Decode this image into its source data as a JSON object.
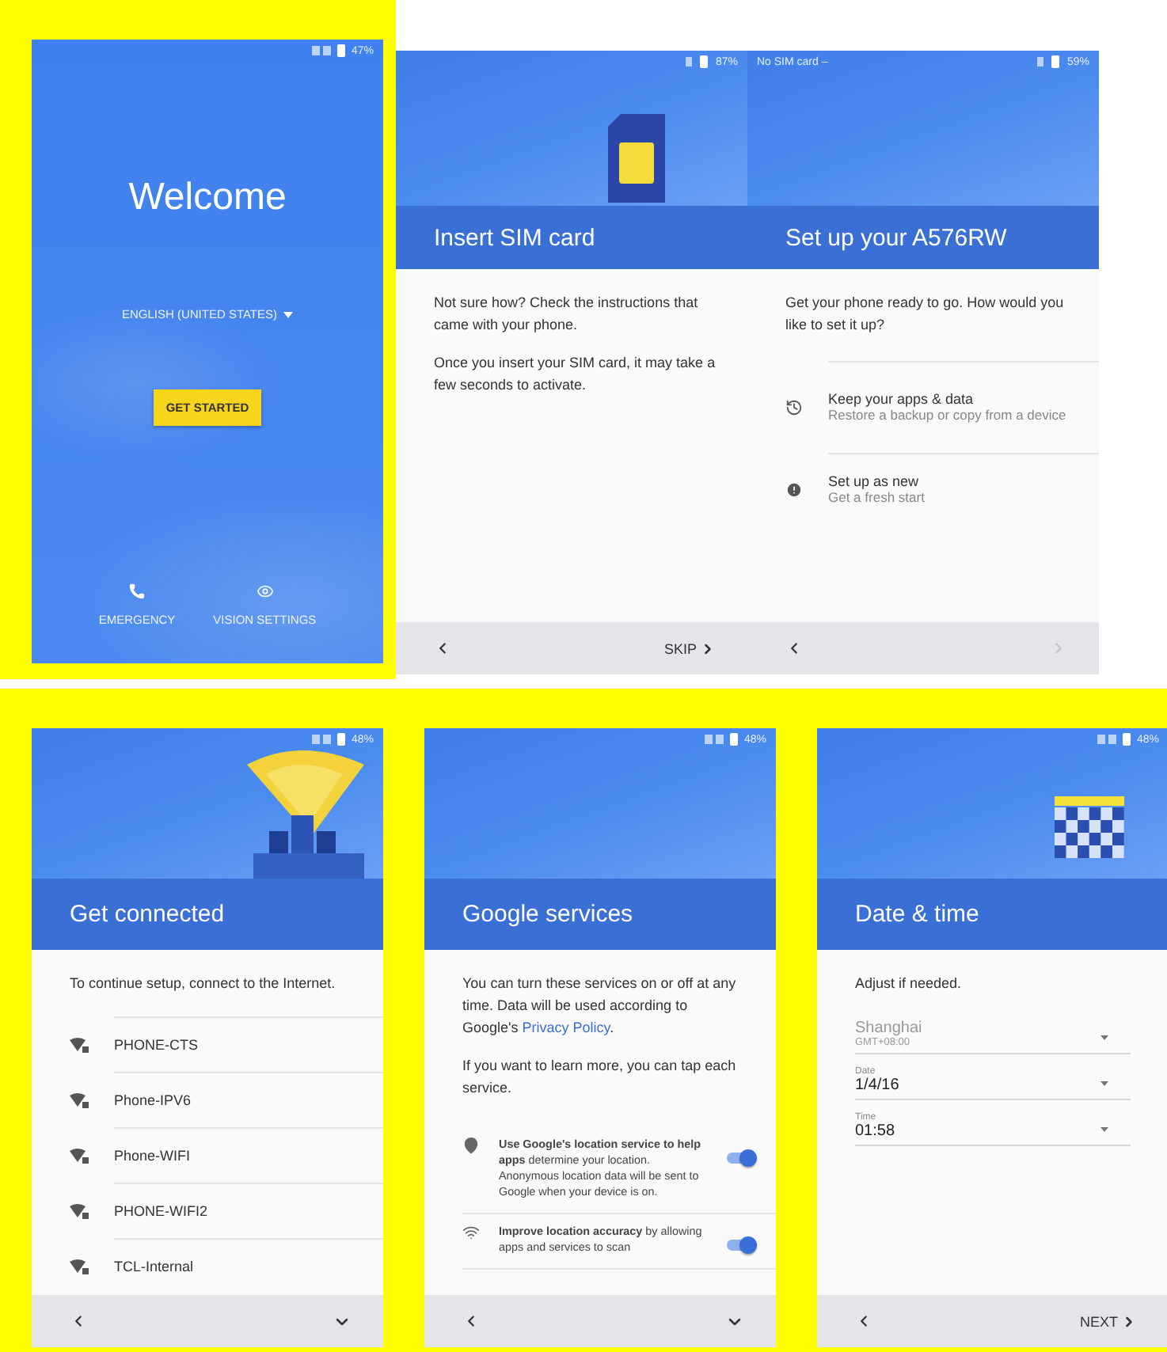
{
  "rows": [
    {
      "highlighted": false,
      "screens": [
        {
          "kind": "welcome",
          "highlighted": true,
          "battery": "47%",
          "title": "Welcome",
          "language": "ENGLISH (UNITED STATES)",
          "button": "GET STARTED",
          "actions": [
            "EMERGENCY",
            "VISION SETTINGS"
          ]
        },
        {
          "kind": "sim",
          "highlighted": false,
          "battery": "87%",
          "title": "Insert SIM card",
          "paragraphs": [
            "Not sure how? Check the instructions that came with your phone.",
            "Once you insert your SIM card, it may take a few seconds to activate."
          ],
          "next": {
            "kind": "labeled",
            "label": "SKIP",
            "disabled": false
          }
        },
        {
          "kind": "setup",
          "highlighted": false,
          "carrier": "No SIM card –",
          "battery": "59%",
          "title": "Set up your A576RW",
          "paragraphs": [
            "Get your phone ready to go. How would you like to set it up?"
          ],
          "options": [
            {
              "title": "Keep your apps & data",
              "subtitle": "Restore a backup or copy from a device"
            },
            {
              "title": "Set up as new",
              "subtitle": "Get a fresh start"
            }
          ],
          "next": {
            "kind": "arrow",
            "disabled": true
          }
        }
      ]
    },
    {
      "highlighted": true,
      "screens": [
        {
          "kind": "wifi",
          "highlighted": false,
          "battery": "48%",
          "title": "Get connected",
          "paragraphs": [
            "To continue setup, connect to the Internet."
          ],
          "networks": [
            "PHONE-CTS",
            "Phone-IPV6",
            "Phone-WIFI",
            "PHONE-WIFI2",
            "TCL-Internal"
          ],
          "next": {
            "kind": "more",
            "disabled": false
          }
        },
        {
          "kind": "services",
          "highlighted": false,
          "battery": "48%",
          "title": "Google services",
          "intro": {
            "text": "You can turn these services on or off at any time. Data will be used according to Google's ",
            "link": "Privacy Policy",
            "after": "."
          },
          "paragraphs": [
            "If you want to learn more, you can tap each service."
          ],
          "services": [
            {
              "text": "**Use Google's location service to help apps** determine your location. Anonymous location data will be sent to Google when your device is on.",
              "on": true
            },
            {
              "text": "**Improve location accuracy** by allowing apps and services to scan",
              "on": true
            }
          ],
          "next": {
            "kind": "more",
            "disabled": false
          }
        },
        {
          "kind": "datetime",
          "highlighted": false,
          "battery": "48%",
          "title": "Date & time",
          "paragraphs": [
            "Adjust if needed."
          ],
          "fields": [
            {
              "value": "Shanghai",
              "sub": "GMT+08:00",
              "disabled": true
            },
            {
              "label": "Date",
              "value": "1/4/16",
              "disabled": false
            },
            {
              "label": "Time",
              "value": "01:58",
              "disabled": false
            }
          ],
          "next": {
            "kind": "labeled",
            "label": "NEXT",
            "disabled": false
          }
        }
      ]
    }
  ]
}
